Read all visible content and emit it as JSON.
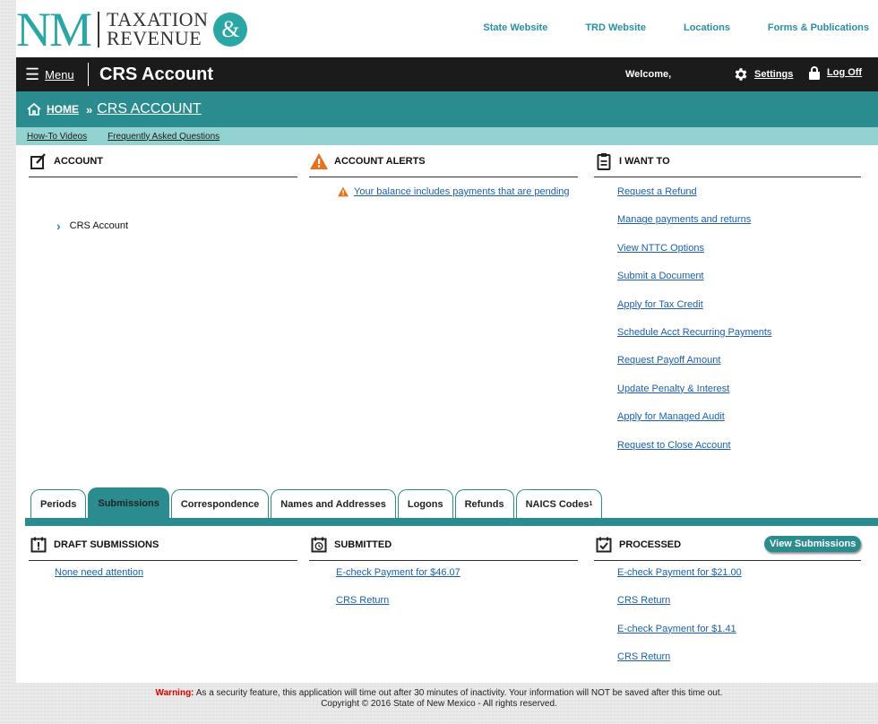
{
  "header": {
    "logo_nm": "NM",
    "logo_line1": "TAXATION",
    "logo_line2": "REVENUE",
    "logo_amp": "&",
    "links": [
      "State Website",
      "TRD Website",
      "Locations",
      "Forms & Publications"
    ]
  },
  "topbar": {
    "menu_label": "Menu",
    "title": "CRS Account",
    "welcome": "Welcome,",
    "settings_label": "Settings",
    "logoff_label": "Log Off"
  },
  "breadcrumb": {
    "home": "HOME",
    "separator": "»",
    "current": "CRS ACCOUNT"
  },
  "subnav": [
    "How-To Videos",
    "Frequently Asked Questions"
  ],
  "account": {
    "heading": "ACCOUNT",
    "items": [
      "CRS Account"
    ]
  },
  "alerts": {
    "heading": "ACCOUNT ALERTS",
    "items": [
      "Your balance includes payments that are pending"
    ]
  },
  "iwant": {
    "heading": "I WANT TO",
    "items": [
      "Request a Refund",
      "Manage payments and returns",
      "View NTTC Options",
      "Submit a Document",
      "Apply for Tax Credit",
      "Schedule Acct Recurring Payments",
      "Request Payoff Amount",
      "Update Penalty & Interest",
      "Apply for Managed Audit",
      "Request to Close Account"
    ]
  },
  "tabs": {
    "items": [
      "Periods",
      "Submissions",
      "Correspondence",
      "Names and Addresses",
      "Logons",
      "Refunds",
      "NAICS Codes"
    ],
    "naics_sup": "1",
    "active": "Submissions"
  },
  "draft": {
    "heading": "DRAFT SUBMISSIONS",
    "items": [
      "None need attention"
    ]
  },
  "submitted": {
    "heading": "SUBMITTED",
    "items": [
      "E-check Payment for $46.07",
      "CRS Return"
    ]
  },
  "processed": {
    "heading": "PROCESSED",
    "button": "View Submissions",
    "items": [
      "E-check Payment for $21.00",
      "CRS Return",
      "E-check Payment for $1.41",
      "CRS Return"
    ]
  },
  "footer": {
    "warning_label": "Warning:",
    "warning_text": "As a security feature, this application will time out after 30 minutes of inactivity. Your information will NOT be saved after this time out.",
    "copyright": "Copyright © 2016 State of New Mexico - All rights reserved."
  },
  "colors": {
    "teal": "#2a8c8e",
    "light_teal": "#92d2d0",
    "link": "#1a5fae",
    "alert_orange": "#e8711c",
    "warning_red": "#dd0000"
  }
}
